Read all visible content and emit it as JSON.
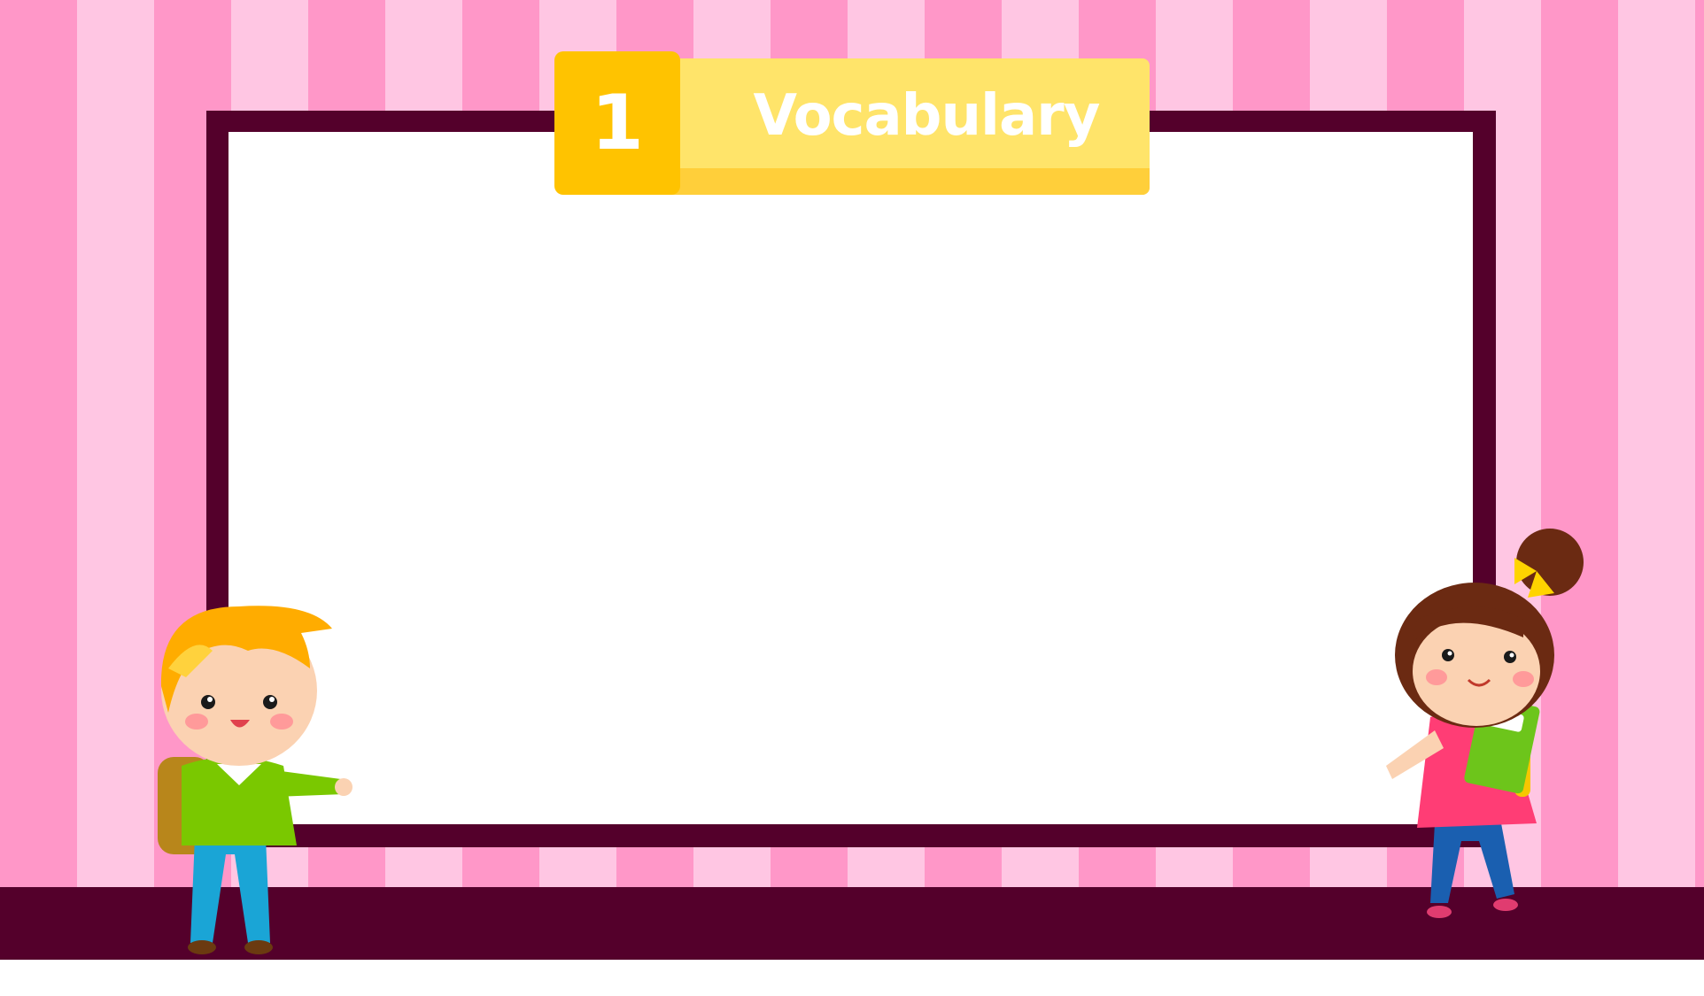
{
  "banner": {
    "number": "1",
    "title": "Vocabulary"
  },
  "colors": {
    "stripe_dark": "#ff97c8",
    "stripe_light": "#ffc6e3",
    "frame": "#54002b",
    "banner_number_bg": "#ffc300",
    "banner_bar_bg": "#ffe46a",
    "banner_text": "#ffffff"
  },
  "illustrations": {
    "left": "boy-with-backpack-icon",
    "right": "girl-with-book-icon"
  }
}
